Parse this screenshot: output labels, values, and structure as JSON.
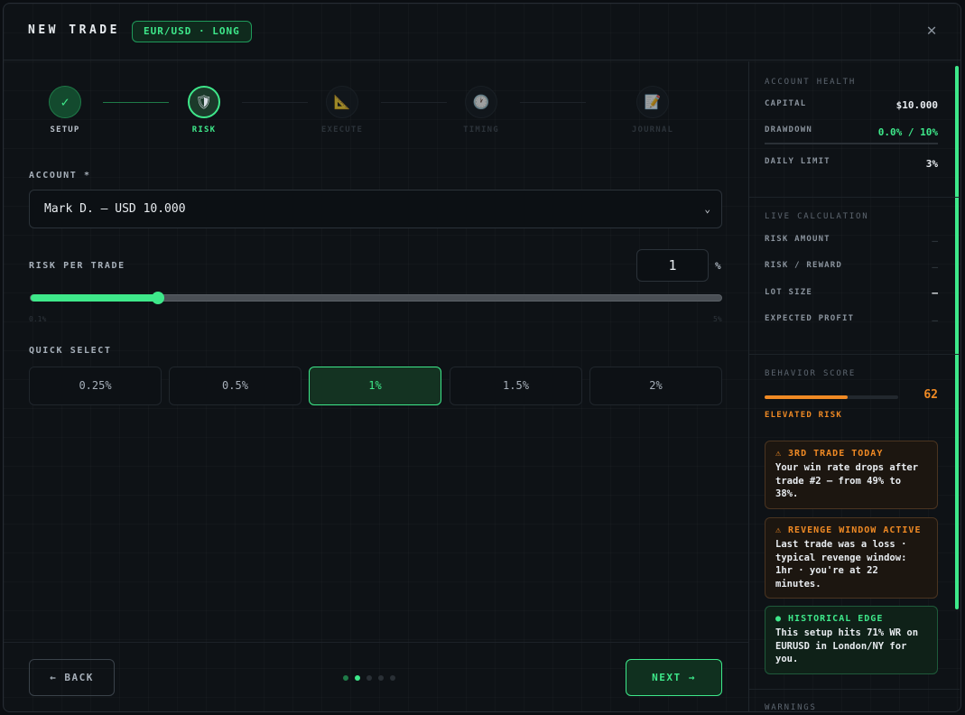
{
  "header": {
    "title": "NEW TRADE",
    "pair_badge": "EUR/USD · LONG",
    "close_glyph": "✕"
  },
  "stepper": [
    {
      "label": "SETUP",
      "icon": "checkmark-icon",
      "glyph": "✓",
      "state": "done"
    },
    {
      "label": "RISK",
      "icon": "shield-icon",
      "glyph": "🛡",
      "state": "active"
    },
    {
      "label": "EXECUTE",
      "icon": "triangle-ruler-icon",
      "glyph": "📐",
      "state": "todo"
    },
    {
      "label": "TIMING",
      "icon": "clock-icon",
      "glyph": "🕐",
      "state": "todo"
    },
    {
      "label": "JOURNAL",
      "icon": "memo-icon",
      "glyph": "📝",
      "state": "todo"
    }
  ],
  "account": {
    "label": "ACCOUNT *",
    "selected": "Mark D. — USD 10.000"
  },
  "risk": {
    "label": "RISK PER TRADE",
    "value": "1",
    "unit": "%",
    "min_label": "0.1%",
    "max_label": "5%",
    "min": 0.1,
    "max": 5,
    "current": 1
  },
  "quick_select": {
    "label": "QUICK SELECT",
    "options": [
      "0.25%",
      "0.5%",
      "1%",
      "1.5%",
      "2%"
    ],
    "selected_index": 2
  },
  "footer": {
    "back_label": "← BACK",
    "next_label": "NEXT →",
    "page_count": 5,
    "current_page": 2
  },
  "side": {
    "account_health": {
      "title": "ACCOUNT HEALTH",
      "capital_label": "CAPITAL",
      "capital_value": "$10.000",
      "drawdown_label": "DRAWDOWN",
      "drawdown_value": "0.0% / 10%",
      "daily_limit_label": "DAILY LIMIT",
      "daily_limit_value": "3%"
    },
    "live_calc": {
      "title": "LIVE CALCULATION",
      "risk_amount_label": "RISK AMOUNT",
      "risk_amount_value": "—",
      "risk_reward_label": "RISK / REWARD",
      "risk_reward_value": "—",
      "lot_size_label": "LOT SIZE",
      "lot_size_value": "—",
      "expected_profit_label": "EXPECTED PROFIT",
      "expected_profit_value": "—"
    },
    "behavior": {
      "title": "BEHAVIOR SCORE",
      "score": "62",
      "score_fraction": 0.62,
      "status": "ELEVATED RISK"
    },
    "cards": [
      {
        "type": "warn",
        "title": "⚠ 3RD TRADE TODAY",
        "body": "Your win rate drops after trade #2 — from 49% to 38%."
      },
      {
        "type": "warn",
        "title": "⚠ REVENGE WINDOW ACTIVE",
        "body": "Last trade was a loss · typical revenge window: 1hr · you're at 22 minutes."
      },
      {
        "type": "good",
        "title": "● HISTORICAL EDGE",
        "body": "This setup hits 71% WR on EURUSD in London/NY for you."
      }
    ],
    "warnings_title": "WARNINGS"
  },
  "colors": {
    "accent": "#3ee88a",
    "warning": "#f08a24",
    "background": "#0e1216"
  }
}
